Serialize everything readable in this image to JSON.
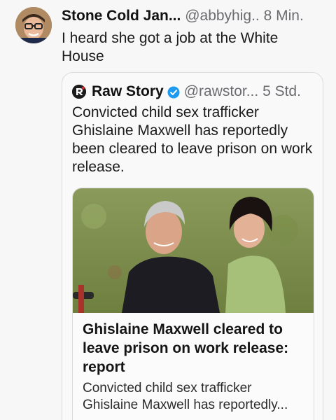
{
  "post": {
    "author_name": "Stone Cold Jan...",
    "handle": "@abbyhig..",
    "time": "8 Min.",
    "text": "I heard she got a job at the White House"
  },
  "quote": {
    "author_name": "Raw Story",
    "handle": "@rawstor...",
    "time": "5 Std.",
    "text": "Convicted child sex trafficker Ghislaine Maxwell has reportedly been cleared to leave prison on work release."
  },
  "link_card": {
    "title": "Ghislaine Maxwell cleared to leave prison on work release: report",
    "description": "Convicted child sex trafficker Ghislaine Maxwell has reportedly..."
  },
  "icons": {
    "avatar": "user-avatar-photo",
    "source_logo": "raw-story-logo",
    "verified": "verified-badge-icon"
  },
  "colors": {
    "background": "#f7f7f8",
    "muted_text": "#6b6b70",
    "verified": "#1d9bf0",
    "border": "#dcdce0"
  }
}
